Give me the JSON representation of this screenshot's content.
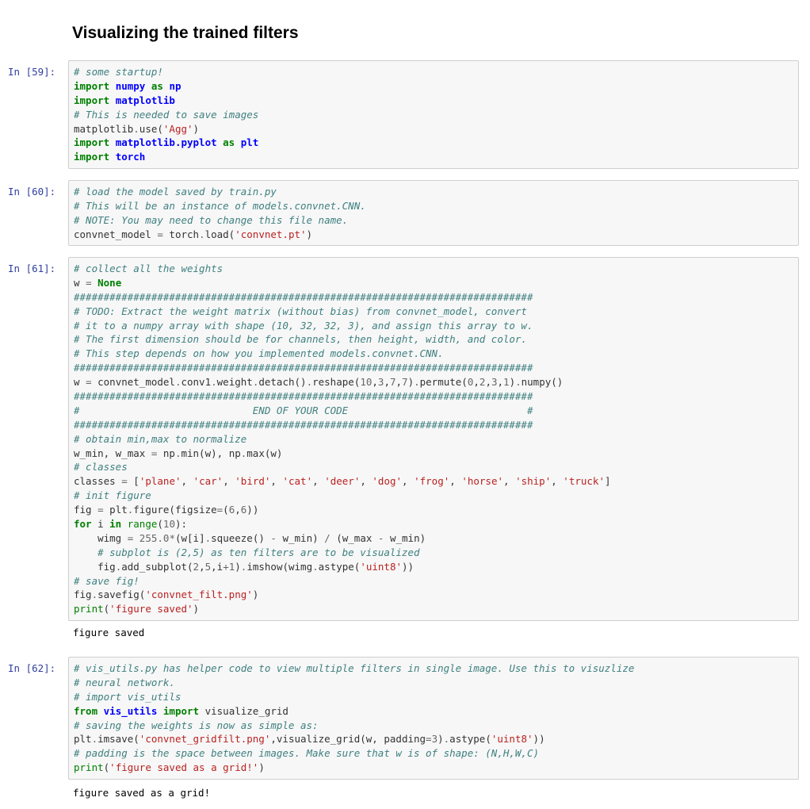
{
  "heading": "Visualizing the trained filters",
  "cells": [
    {
      "prompt": "In [59]:",
      "lines": [
        [
          [
            "c",
            "# some startup!"
          ]
        ],
        [
          [
            "k",
            "import"
          ],
          [
            "t",
            " "
          ],
          [
            "n",
            "numpy"
          ],
          [
            "t",
            " "
          ],
          [
            "k",
            "as"
          ],
          [
            "t",
            " "
          ],
          [
            "n",
            "np"
          ]
        ],
        [
          [
            "k",
            "import"
          ],
          [
            "t",
            " "
          ],
          [
            "n",
            "matplotlib"
          ]
        ],
        [
          [
            "c",
            "# This is needed to save images"
          ]
        ],
        [
          [
            "t",
            "matplotlib"
          ],
          [
            "o",
            "."
          ],
          [
            "t",
            "use("
          ],
          [
            "s",
            "'Agg'"
          ],
          [
            "t",
            ")"
          ]
        ],
        [
          [
            "k",
            "import"
          ],
          [
            "t",
            " "
          ],
          [
            "n",
            "matplotlib.pyplot"
          ],
          [
            "t",
            " "
          ],
          [
            "k",
            "as"
          ],
          [
            "t",
            " "
          ],
          [
            "n",
            "plt"
          ]
        ],
        [
          [
            "k",
            "import"
          ],
          [
            "t",
            " "
          ],
          [
            "n",
            "torch"
          ]
        ]
      ]
    },
    {
      "prompt": "In [60]:",
      "lines": [
        [
          [
            "c",
            "# load the model saved by train.py"
          ]
        ],
        [
          [
            "c",
            "# This will be an instance of models.convnet.CNN."
          ]
        ],
        [
          [
            "c",
            "# NOTE: You may need to change this file name."
          ]
        ],
        [
          [
            "t",
            "convnet_model "
          ],
          [
            "o",
            "="
          ],
          [
            "t",
            " torch"
          ],
          [
            "o",
            "."
          ],
          [
            "t",
            "load("
          ],
          [
            "s",
            "'convnet.pt'"
          ],
          [
            "t",
            ")"
          ]
        ]
      ]
    },
    {
      "prompt": "In [61]:",
      "lines": [
        [
          [
            "c",
            "# collect all the weights"
          ]
        ],
        [
          [
            "t",
            "w "
          ],
          [
            "o",
            "="
          ],
          [
            "t",
            " "
          ],
          [
            "kc",
            "None"
          ]
        ],
        [
          [
            "c",
            "#############################################################################"
          ]
        ],
        [
          [
            "c",
            "# TODO: Extract the weight matrix (without bias) from convnet_model, convert"
          ]
        ],
        [
          [
            "c",
            "# it to a numpy array with shape (10, 32, 32, 3), and assign this array to w."
          ]
        ],
        [
          [
            "c",
            "# The first dimension should be for channels, then height, width, and color."
          ]
        ],
        [
          [
            "c",
            "# This step depends on how you implemented models.convnet.CNN."
          ]
        ],
        [
          [
            "c",
            "#############################################################################"
          ]
        ],
        [
          [
            "t",
            "w "
          ],
          [
            "o",
            "="
          ],
          [
            "t",
            " convnet_model"
          ],
          [
            "o",
            "."
          ],
          [
            "t",
            "conv1"
          ],
          [
            "o",
            "."
          ],
          [
            "t",
            "weight"
          ],
          [
            "o",
            "."
          ],
          [
            "t",
            "detach()"
          ],
          [
            "o",
            "."
          ],
          [
            "t",
            "reshape("
          ],
          [
            "o",
            "10"
          ],
          [
            "t",
            ","
          ],
          [
            "o",
            "3"
          ],
          [
            "t",
            ","
          ],
          [
            "o",
            "7"
          ],
          [
            "t",
            ","
          ],
          [
            "o",
            "7"
          ],
          [
            "t",
            ")"
          ],
          [
            "o",
            "."
          ],
          [
            "t",
            "permute("
          ],
          [
            "o",
            "0"
          ],
          [
            "t",
            ","
          ],
          [
            "o",
            "2"
          ],
          [
            "t",
            ","
          ],
          [
            "o",
            "3"
          ],
          [
            "t",
            ","
          ],
          [
            "o",
            "1"
          ],
          [
            "t",
            ")"
          ],
          [
            "o",
            "."
          ],
          [
            "t",
            "numpy()"
          ]
        ],
        [
          [
            "c",
            "#############################################################################"
          ]
        ],
        [
          [
            "c",
            "#                             END OF YOUR CODE                              #"
          ]
        ],
        [
          [
            "c",
            "#############################################################################"
          ]
        ],
        [
          [
            "c",
            "# obtain min,max to normalize"
          ]
        ],
        [
          [
            "t",
            "w_min, w_max "
          ],
          [
            "o",
            "="
          ],
          [
            "t",
            " np"
          ],
          [
            "o",
            "."
          ],
          [
            "t",
            "min(w), np"
          ],
          [
            "o",
            "."
          ],
          [
            "t",
            "max(w)"
          ]
        ],
        [
          [
            "c",
            "# classes"
          ]
        ],
        [
          [
            "t",
            "classes "
          ],
          [
            "o",
            "="
          ],
          [
            "t",
            " ["
          ],
          [
            "s",
            "'plane'"
          ],
          [
            "t",
            ", "
          ],
          [
            "s",
            "'car'"
          ],
          [
            "t",
            ", "
          ],
          [
            "s",
            "'bird'"
          ],
          [
            "t",
            ", "
          ],
          [
            "s",
            "'cat'"
          ],
          [
            "t",
            ", "
          ],
          [
            "s",
            "'deer'"
          ],
          [
            "t",
            ", "
          ],
          [
            "s",
            "'dog'"
          ],
          [
            "t",
            ", "
          ],
          [
            "s",
            "'frog'"
          ],
          [
            "t",
            ", "
          ],
          [
            "s",
            "'horse'"
          ],
          [
            "t",
            ", "
          ],
          [
            "s",
            "'ship'"
          ],
          [
            "t",
            ", "
          ],
          [
            "s",
            "'truck'"
          ],
          [
            "t",
            "]"
          ]
        ],
        [
          [
            "c",
            "# init figure"
          ]
        ],
        [
          [
            "t",
            "fig "
          ],
          [
            "o",
            "="
          ],
          [
            "t",
            " plt"
          ],
          [
            "o",
            "."
          ],
          [
            "t",
            "figure(figsize"
          ],
          [
            "o",
            "="
          ],
          [
            "t",
            "("
          ],
          [
            "o",
            "6"
          ],
          [
            "t",
            ","
          ],
          [
            "o",
            "6"
          ],
          [
            "t",
            "))"
          ]
        ],
        [
          [
            "k",
            "for"
          ],
          [
            "t",
            " i "
          ],
          [
            "k",
            "in"
          ],
          [
            "t",
            " "
          ],
          [
            "b",
            "range"
          ],
          [
            "t",
            "("
          ],
          [
            "o",
            "10"
          ],
          [
            "t",
            "):"
          ]
        ],
        [
          [
            "t",
            "    wimg "
          ],
          [
            "o",
            "="
          ],
          [
            "t",
            " "
          ],
          [
            "o",
            "255.0"
          ],
          [
            "o",
            "*"
          ],
          [
            "t",
            "(w[i]"
          ],
          [
            "o",
            "."
          ],
          [
            "t",
            "squeeze() "
          ],
          [
            "o",
            "-"
          ],
          [
            "t",
            " w_min) "
          ],
          [
            "o",
            "/"
          ],
          [
            "t",
            " (w_max "
          ],
          [
            "o",
            "-"
          ],
          [
            "t",
            " w_min)"
          ]
        ],
        [
          [
            "t",
            "    "
          ],
          [
            "c",
            "# subplot is (2,5) as ten filters are to be visualized"
          ]
        ],
        [
          [
            "t",
            "    fig"
          ],
          [
            "o",
            "."
          ],
          [
            "t",
            "add_subplot("
          ],
          [
            "o",
            "2"
          ],
          [
            "t",
            ","
          ],
          [
            "o",
            "5"
          ],
          [
            "t",
            ",i"
          ],
          [
            "o",
            "+1"
          ],
          [
            "t",
            ")"
          ],
          [
            "o",
            "."
          ],
          [
            "t",
            "imshow(wimg"
          ],
          [
            "o",
            "."
          ],
          [
            "t",
            "astype("
          ],
          [
            "s",
            "'uint8'"
          ],
          [
            "t",
            "))"
          ]
        ],
        [
          [
            "c",
            "# save fig!"
          ]
        ],
        [
          [
            "t",
            "fig"
          ],
          [
            "o",
            "."
          ],
          [
            "t",
            "savefig("
          ],
          [
            "s",
            "'convnet_filt.png'"
          ],
          [
            "t",
            ")"
          ]
        ],
        [
          [
            "b",
            "print"
          ],
          [
            "t",
            "("
          ],
          [
            "s",
            "'figure saved'"
          ],
          [
            "t",
            ")"
          ]
        ]
      ],
      "output": "figure saved"
    },
    {
      "prompt": "In [62]:",
      "lines": [
        [
          [
            "c",
            "# vis_utils.py has helper code to view multiple filters in single image. Use this to visuzlize"
          ]
        ],
        [
          [
            "c",
            "# neural network."
          ]
        ],
        [
          [
            "c",
            "# import vis_utils"
          ]
        ],
        [
          [
            "k",
            "from"
          ],
          [
            "t",
            " "
          ],
          [
            "n",
            "vis_utils"
          ],
          [
            "t",
            " "
          ],
          [
            "k",
            "import"
          ],
          [
            "t",
            " visualize_grid"
          ]
        ],
        [
          [
            "c",
            "# saving the weights is now as simple as:"
          ]
        ],
        [
          [
            "t",
            "plt"
          ],
          [
            "o",
            "."
          ],
          [
            "t",
            "imsave("
          ],
          [
            "s",
            "'convnet_gridfilt.png'"
          ],
          [
            "t",
            ",visualize_grid(w, padding"
          ],
          [
            "o",
            "="
          ],
          [
            "o",
            "3"
          ],
          [
            "t",
            ")"
          ],
          [
            "o",
            "."
          ],
          [
            "t",
            "astype("
          ],
          [
            "s",
            "'uint8'"
          ],
          [
            "t",
            "))"
          ]
        ],
        [
          [
            "c",
            "# padding is the space between images. Make sure that w is of shape: (N,H,W,C)"
          ]
        ],
        [
          [
            "b",
            "print"
          ],
          [
            "t",
            "("
          ],
          [
            "s",
            "'figure saved as a grid!'"
          ],
          [
            "t",
            ")"
          ]
        ]
      ],
      "output": "figure saved as a grid!"
    }
  ]
}
